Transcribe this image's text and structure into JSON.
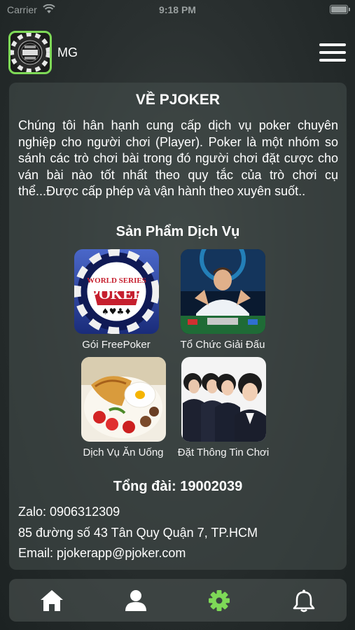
{
  "status_bar": {
    "carrier": "Carrier",
    "time": "9:18 PM"
  },
  "header": {
    "app_name": "MG",
    "logo_icon": "poker-chip-logo-icon",
    "menu_icon": "hamburger-menu-icon"
  },
  "about": {
    "title": "VỀ PJOKER",
    "description": "Chúng tôi hân hạnh cung cấp dịch vụ poker chuyên nghiệp cho người chơi (Player). Poker là một nhóm so sánh các trò chơi bài trong đó người chơi đặt cược cho ván bài nào tốt nhất theo quy tắc của trò chơi cụ thể...Được cấp phép và vận hành theo xuyên suốt.."
  },
  "services": {
    "title": "Sản Phẩm Dịch Vụ",
    "items": [
      {
        "label": "Gói FreePoker",
        "image": "world-series-poker-logo"
      },
      {
        "label": "Tổ Chức Giải Đấu",
        "image": "poker-tournament-photo"
      },
      {
        "label": "Dịch Vụ Ăn Uống",
        "image": "food-plate-photo"
      },
      {
        "label": "Đặt Thông Tin Chơi",
        "image": "call-center-staff-photo"
      }
    ],
    "logo_text": {
      "line1": "WORLD SERIES",
      "line2": "POKER"
    }
  },
  "contact": {
    "hotline": "Tổng đài: 19002039",
    "zalo": "Zalo: 0906312309",
    "address": "85 đường số 43 Tân Quy Quận 7, TP.HCM",
    "email": "Email: pjokerapp@pjoker.com"
  },
  "tab_bar": {
    "tabs": [
      {
        "icon": "home-icon",
        "active": false
      },
      {
        "icon": "user-icon",
        "active": false
      },
      {
        "icon": "gear-icon",
        "active": true
      },
      {
        "icon": "bell-icon",
        "active": false
      }
    ]
  },
  "colors": {
    "accent": "#7ed957",
    "tab_inactive": "#ffffff",
    "text": "#ffffff"
  }
}
